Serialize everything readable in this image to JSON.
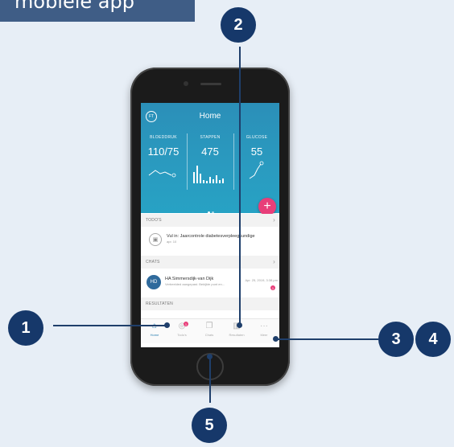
{
  "page_title": "mobiele app",
  "annotations": [
    "1",
    "2",
    "3",
    "4",
    "5"
  ],
  "app": {
    "header": {
      "avatar_initials": "FT",
      "title": "Home",
      "metrics": [
        {
          "label": "BLOEDDRUK",
          "value": "110/75"
        },
        {
          "label": "STAPPEN",
          "value": "475"
        },
        {
          "label": "GLUCOSE",
          "value": "55"
        }
      ],
      "fab_label": "+"
    },
    "todos": {
      "heading": "TODO'S",
      "item_text": "Vul in: Jaarcontrole diabetesverpleegkundige",
      "item_sub": "apr. 10"
    },
    "chats": {
      "heading": "CHATS",
      "initials": "HD",
      "name": "HA Simmersdijk-van Dijk",
      "message": "Verbeelded aangepast. Bekijkte punt en...",
      "time": "Apr. 25, 2019, 3:38 pm",
      "unread": "1"
    },
    "results": {
      "heading": "RESULTATEN"
    },
    "navbar": [
      {
        "label": "Home",
        "icon": "home-icon"
      },
      {
        "label": "Todo's",
        "icon": "checklist-icon",
        "badge": "1"
      },
      {
        "label": "Chats",
        "icon": "chat-icon"
      },
      {
        "label": "Resultaten",
        "icon": "bar-chart-icon"
      },
      {
        "label": "Meer",
        "icon": "more-icon"
      }
    ]
  },
  "colors": {
    "page_background": "#e7eef6",
    "title_box": "#3f5d86",
    "callout": "#16386a",
    "header_teal": "#2a9bc0",
    "accent_pink": "#e83e79"
  }
}
